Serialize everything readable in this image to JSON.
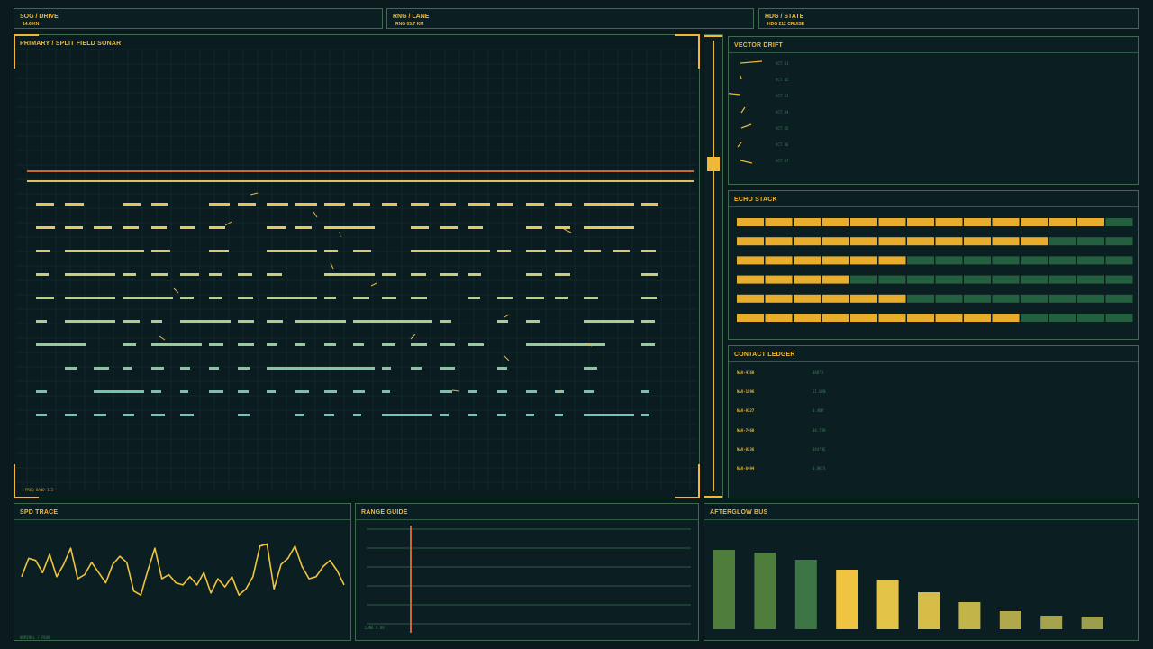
{
  "stats": [
    {
      "title": "SOG / DRIVE",
      "value": "14.6 KN"
    },
    {
      "title": "RNG / LANE",
      "value": "RNG 05.7 KM"
    },
    {
      "title": "HDG / STATE",
      "value": "HDG 212  CRUISE"
    }
  ],
  "sonar": {
    "title": "PRIMARY / SPLIT FIELD SONAR",
    "footer": "FREQ BAND III"
  },
  "vector": {
    "title": "VECTOR DRIFT",
    "labels": [
      "VCT 01",
      "VCT 02",
      "VCT 03",
      "VCT 04",
      "VCT 05",
      "VCT 06",
      "VCT 07"
    ]
  },
  "echo": {
    "title": "ECHO STACK",
    "levels": [
      13,
      11,
      6,
      4,
      6,
      10
    ],
    "segments": 14
  },
  "ledger": {
    "title": "CONTACT LEDGER",
    "rows": [
      {
        "id": "NAV-4160",
        "val": "040°N"
      },
      {
        "id": "NAV-1896",
        "val": "11.0KN"
      },
      {
        "id": "NAV-9327",
        "val": "0.4NM"
      },
      {
        "id": "NAV-7460",
        "val": "04.7SM"
      },
      {
        "id": "NAV-9236",
        "val": "044°NE"
      },
      {
        "id": "NAV-8494",
        "val": "0.8KTS"
      }
    ]
  },
  "spd": {
    "title": "SPD TRACE",
    "footer": "NOMINAL / PEAK",
    "values": [
      52,
      61,
      60,
      54,
      63,
      52,
      58,
      66,
      51,
      53,
      59,
      54,
      49,
      58,
      62,
      59,
      45,
      43,
      55,
      66,
      51,
      53,
      49,
      48,
      52,
      48,
      54,
      44,
      51,
      47,
      52,
      43,
      46,
      52,
      67,
      68,
      46,
      58,
      61,
      67,
      57,
      51,
      52,
      57,
      60,
      55,
      48
    ]
  },
  "range": {
    "title": "RANGE GUIDE",
    "footer": "LANE 0.88"
  },
  "afterglow": {
    "title": "AFTERGLOW BUS",
    "values": [
      88,
      85,
      77,
      66,
      54,
      41,
      30,
      20,
      15,
      14
    ]
  }
}
